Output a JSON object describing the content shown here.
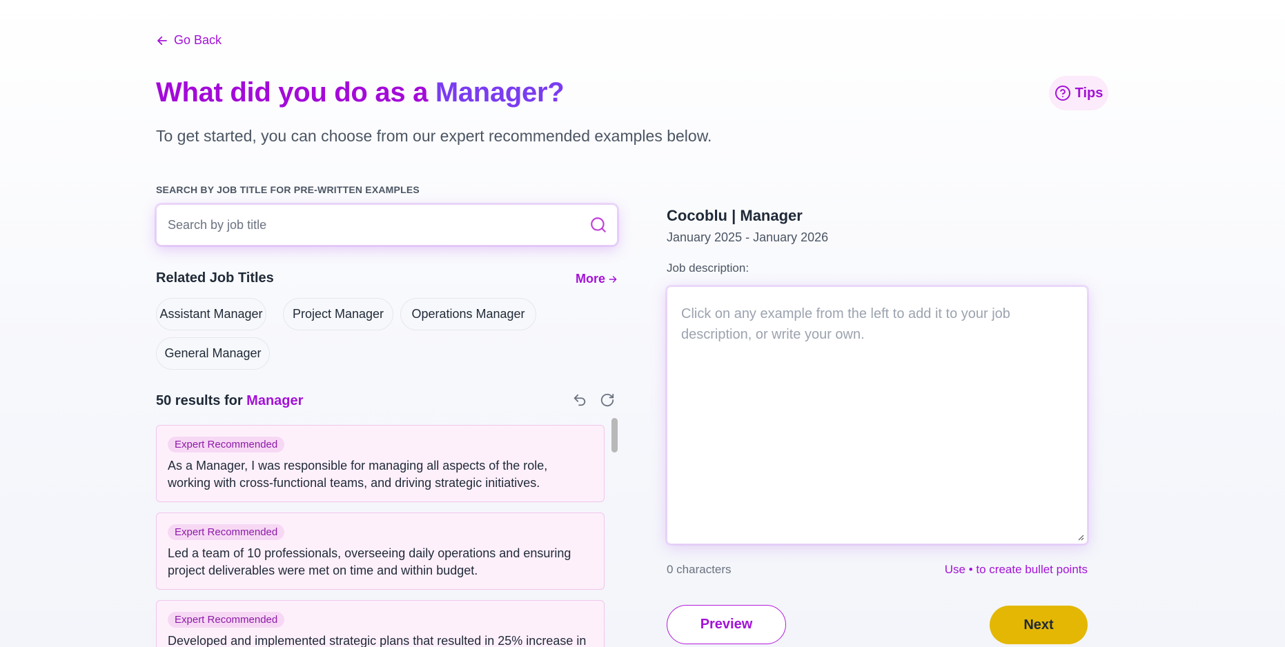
{
  "nav": {
    "go_back_label": "Go Back"
  },
  "header": {
    "title_prefix": "What did you do as a ",
    "title_role": "Manager?",
    "subtitle": "To get started, you can choose from our expert recommended examples below.",
    "tips_label": "Tips"
  },
  "search": {
    "caption": "SEARCH BY JOB TITLE FOR PRE-WRITTEN EXAMPLES",
    "placeholder": "Search by job title",
    "value": ""
  },
  "related": {
    "title": "Related Job Titles",
    "more_label": "More",
    "chips": [
      "Assistant Manager",
      "Project Manager",
      "Operations Manager",
      "General Manager"
    ]
  },
  "results": {
    "count_text": "50 results for",
    "term": "Manager",
    "items": [
      {
        "badge": "Expert Recommended",
        "text": "As a Manager, I was responsible for managing all aspects of the role, working with cross-functional teams, and driving strategic initiatives."
      },
      {
        "badge": "Expert Recommended",
        "text": "Led a team of 10 professionals, overseeing daily operations and ensuring project deliverables were met on time and within budget."
      },
      {
        "badge": "Expert Recommended",
        "text": "Developed and implemented strategic plans that resulted in 25% increase in"
      }
    ]
  },
  "job": {
    "heading": "Cocoblu | Manager",
    "dates": "January 2025 - January 2026",
    "description_label": "Job description:",
    "description_placeholder": "Click on any example from the left to add it to your job description, or write your own.",
    "description_value": "",
    "char_count": "0 characters",
    "bullet_hint": "Use • to create bullet points"
  },
  "actions": {
    "preview_label": "Preview",
    "next_label": "Next"
  },
  "colors": {
    "brand_purple": "#a312d6",
    "accent_violet": "#7a3cf0",
    "next_yellow": "#e3b704",
    "card_bg": "#fdf0fb"
  },
  "icons": [
    "arrow-left-icon",
    "question-circle-icon",
    "search-icon",
    "arrow-right-icon",
    "undo-icon",
    "refresh-icon"
  ]
}
